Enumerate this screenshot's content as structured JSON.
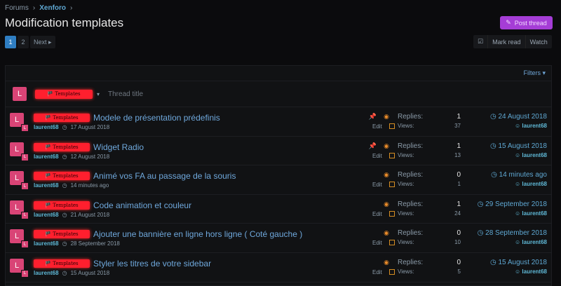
{
  "breadcrumb": {
    "root": "Forums",
    "current": "Xenforo",
    "sep": "›"
  },
  "page_title": "Modification templates",
  "post_thread": {
    "label": "Post thread",
    "icon": "edit-icon"
  },
  "pagination": {
    "pages": [
      "1",
      "2"
    ],
    "active": "1",
    "next": "Next ▸"
  },
  "actions": {
    "mark_read": "Mark read",
    "watch": "Watch"
  },
  "filters": {
    "label": "Filters ▾"
  },
  "header": {
    "avatar": "L",
    "prefix": "🏴 Templates",
    "thread_title_placeholder": "Thread title"
  },
  "threads": [
    {
      "avatar": "L",
      "prefix": "🏴 Templates",
      "title": "Modele de présentation prédefinis",
      "author": "laurent68",
      "start_date": "17 August 2018",
      "pinned": true,
      "edit": "Edit",
      "replies_label": "Replies:",
      "replies": "1",
      "views_label": "Views:",
      "views": "37",
      "last_date": "24 August 2018",
      "last_user": "laurent68"
    },
    {
      "avatar": "L",
      "prefix": "🏴 Templates",
      "title": "Widget Radio",
      "author": "laurent68",
      "start_date": "12 August 2018",
      "pinned": true,
      "edit": "Edit",
      "replies_label": "Replies:",
      "replies": "1",
      "views_label": "Views:",
      "views": "13",
      "last_date": "15 August 2018",
      "last_user": "laurent68"
    },
    {
      "avatar": "L",
      "prefix": "🏴 Templates",
      "title": "Animé vos FA au passage de la souris",
      "author": "laurent68",
      "start_date": "14 minutes ago",
      "pinned": false,
      "edit": "Edit",
      "replies_label": "Replies:",
      "replies": "0",
      "views_label": "Views:",
      "views": "1",
      "last_date": "14 minutes ago",
      "last_user": "laurent68"
    },
    {
      "avatar": "L",
      "prefix": "🏴 Templates",
      "title": "Code animation et couleur",
      "author": "laurent68",
      "start_date": "21 August 2018",
      "pinned": false,
      "edit": "Edit",
      "replies_label": "Replies:",
      "replies": "1",
      "views_label": "Views:",
      "views": "24",
      "last_date": "29 September 2018",
      "last_user": "laurent68"
    },
    {
      "avatar": "L",
      "prefix": "🏴 Templates",
      "title": "Ajouter une bannière en ligne hors ligne ( Coté gauche )",
      "author": "laurent68",
      "start_date": "28 September 2018",
      "pinned": false,
      "edit": "Edit",
      "replies_label": "Replies:",
      "replies": "0",
      "views_label": "Views:",
      "views": "10",
      "last_date": "28 September 2018",
      "last_user": "laurent68"
    },
    {
      "avatar": "L",
      "prefix": "🏴 Templates",
      "title": "Styler les titres de votre sidebar",
      "author": "laurent68",
      "start_date": "15 August 2018",
      "pinned": false,
      "edit": "Edit",
      "replies_label": "Replies:",
      "replies": "0",
      "views_label": "Views:",
      "views": "5",
      "last_date": "15 August 2018",
      "last_user": "laurent68"
    }
  ],
  "colors": {
    "accent": "#5fa8d3",
    "post_button": "#a53dd6",
    "prefix_red": "#ff1f2e",
    "avatar": "#d94476"
  }
}
